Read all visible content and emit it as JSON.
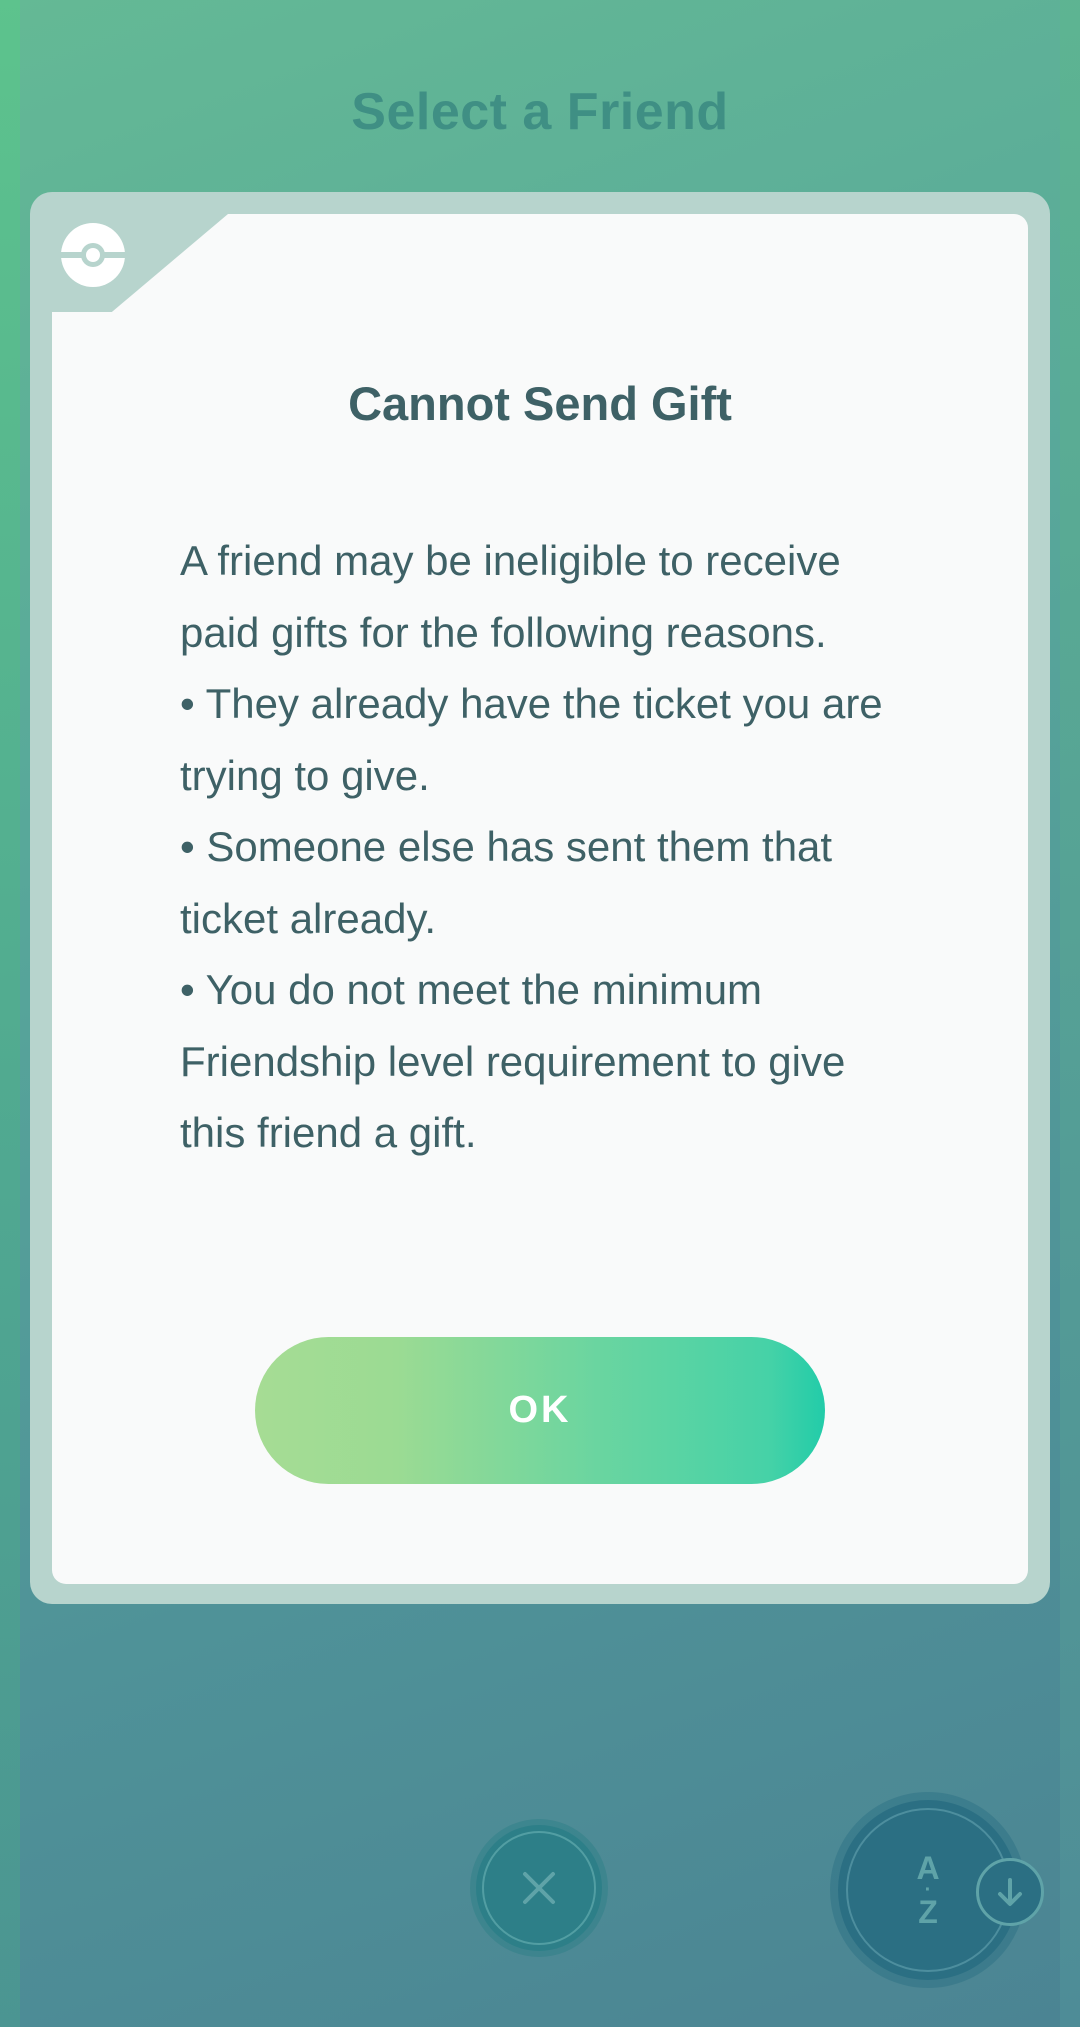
{
  "background": {
    "title": "Select a Friend"
  },
  "dialog": {
    "title": "Cannot Send Gift",
    "body_lines": [
      "A friend may be ineligible to receive paid gifts for the following reasons.",
      "• They already have the ticket you are trying to give.",
      "• Someone else has sent them that ticket already.",
      "• You do not meet the minimum Friendship level requirement to give this friend a gift."
    ],
    "ok_label": "OK"
  },
  "bottom_bar": {
    "close_icon": "close-icon",
    "sort_label_top": "A",
    "sort_label_bottom": "Z",
    "sort_icon": "arrow-down-icon"
  },
  "colors": {
    "accent_gradient_start": "#a6dc94",
    "accent_gradient_end": "#22cca9",
    "text": "#3e6166",
    "background_teal": "#4f9298"
  }
}
